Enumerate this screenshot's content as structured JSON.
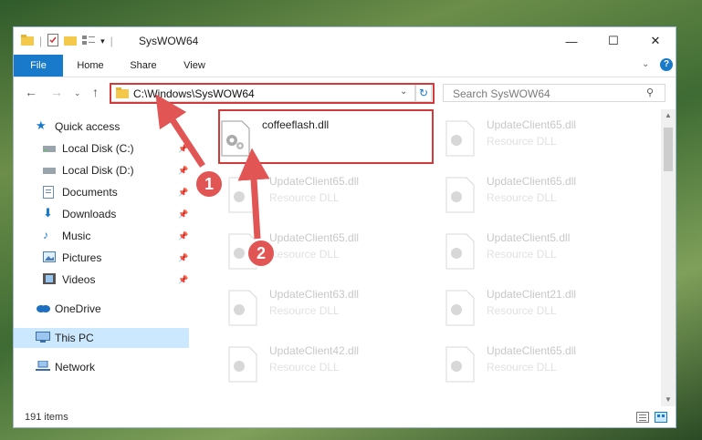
{
  "window": {
    "title": "SysWOW64",
    "controls": {
      "minimize": "—",
      "maximize": "☐",
      "close": "✕"
    }
  },
  "ribbon": {
    "tabs": [
      "File",
      "Home",
      "Share",
      "View"
    ]
  },
  "navigation": {
    "address": "C:\\Windows\\SysWOW64",
    "search_placeholder": "Search SysWOW64"
  },
  "sidebar": {
    "quick_access": "Quick access",
    "items": [
      {
        "label": "Local Disk (C:)",
        "icon": "drive-icon",
        "pinned": true
      },
      {
        "label": "Local Disk (D:)",
        "icon": "drive-icon",
        "pinned": true
      },
      {
        "label": "Documents",
        "icon": "documents-icon",
        "pinned": true
      },
      {
        "label": "Downloads",
        "icon": "downloads-icon",
        "pinned": true
      },
      {
        "label": "Music",
        "icon": "music-icon",
        "pinned": true
      },
      {
        "label": "Pictures",
        "icon": "pictures-icon",
        "pinned": true
      },
      {
        "label": "Videos",
        "icon": "videos-icon",
        "pinned": true
      }
    ],
    "onedrive": "OneDrive",
    "this_pc": "This PC",
    "network": "Network"
  },
  "files": {
    "highlighted": {
      "name": "coffeeflash.dll",
      "type": ""
    },
    "list": [
      {
        "name": "UpdateClient65.dll",
        "type": "Resource DLL"
      },
      {
        "name": "UpdateClient65.dll",
        "type": "Resource DLL"
      },
      {
        "name": "UpdateClient65.dll",
        "type": "Resource DLL"
      },
      {
        "name": "UpdateClient65.dll",
        "type": "Resource DLL"
      },
      {
        "name": "UpdateClient65.dll",
        "type": "Resource DLL"
      },
      {
        "name": "UpdateClient5.dll",
        "type": "Resource DLL"
      },
      {
        "name": "UpdateClient63.dll",
        "type": "Resource DLL"
      },
      {
        "name": "UpdateClient21.dll",
        "type": "Resource DLL"
      },
      {
        "name": "UpdateClient42.dll",
        "type": "Resource DLL"
      },
      {
        "name": "UpdateClient65.dll",
        "type": "Resource DLL"
      }
    ]
  },
  "status": {
    "items_count": "191 items"
  },
  "annotations": {
    "step1": "1",
    "step2": "2",
    "accent_color": "#e25555"
  },
  "colors": {
    "file_tab": "#1979ca",
    "selected": "#cce8ff"
  }
}
